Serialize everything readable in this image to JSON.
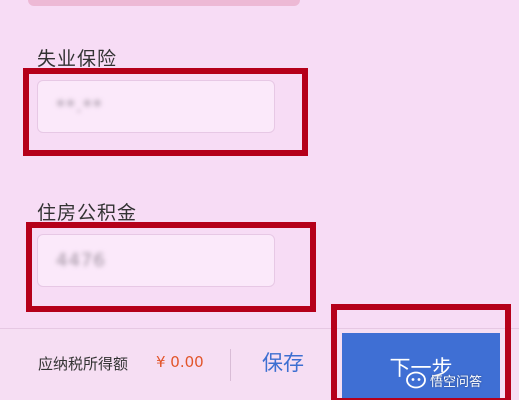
{
  "form": {
    "unemployment_insurance": {
      "label": "失业保险",
      "value": "**.**"
    },
    "housing_fund": {
      "label": "住房公积金",
      "value": "4476"
    }
  },
  "bottom_bar": {
    "tax_label": "应纳税所得额",
    "tax_value": "¥ 0.00",
    "save_label": "保存",
    "next_label": "下一步"
  },
  "watermark": {
    "text": "悟空问答",
    "logo_icon": "wukong-logo-icon"
  },
  "colors": {
    "background": "#f7dcf5",
    "accent_blue": "#3f6fd4",
    "tax_value_orange": "#e2552a",
    "annotation_red": "#b5001a"
  }
}
